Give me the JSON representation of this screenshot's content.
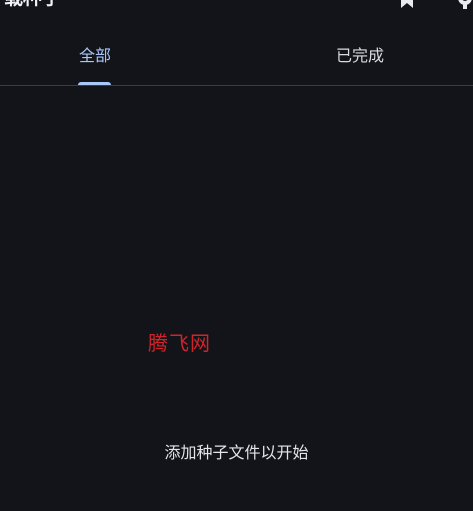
{
  "header": {
    "title": "载种子",
    "icons": [
      "bookmark-icon",
      "settings-gear-icon"
    ]
  },
  "tabs": [
    {
      "label": "全部",
      "selected": true
    },
    {
      "label": "已完成",
      "selected": false
    }
  ],
  "watermark": "腾飞网",
  "empty_state": {
    "message": "添加种子文件以开始"
  },
  "colors": {
    "background": "#121419",
    "accent": "#a8c7fa",
    "watermark": "#d2232a"
  }
}
